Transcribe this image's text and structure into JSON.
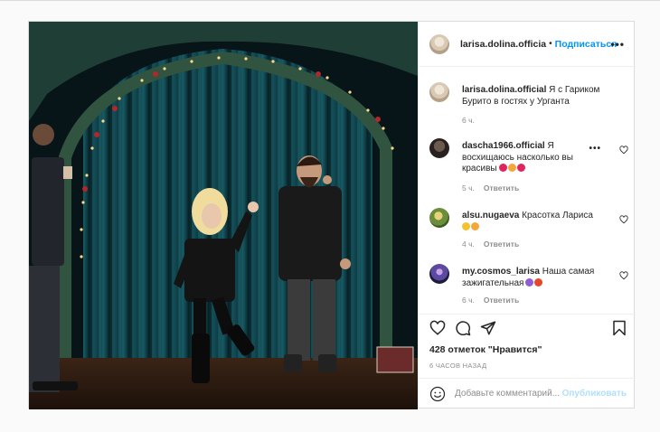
{
  "post": {
    "author": "larisa.dolina.officia",
    "follow_label": "Подписаться",
    "caption_author": "larisa.dolina.official",
    "caption_text": "Я с Гариком Бурито в гостях у Урганта",
    "caption_age": "6 ч.",
    "likes": "428 отметок \"Нравится\"",
    "time_ago": "6 ЧАСОВ НАЗАД",
    "comment_placeholder": "Добавьте комментарий...",
    "publish_label": "Опубликовать"
  },
  "comments": [
    {
      "user": "dascha1966.official",
      "text": "Я восхищаюсь насколько вы красивы",
      "age": "5 ч.",
      "reply": "Ответить",
      "emoji": [
        "red-heart",
        "heart-eyes",
        "red-heart"
      ]
    },
    {
      "user": "alsu.nugaeva",
      "text": "Красотка Лариса",
      "age": "4 ч.",
      "reply": "Ответить",
      "emoji": [
        "clap",
        "heart-eyes"
      ]
    },
    {
      "user": "my.cosmos_larisa",
      "text": "Наша самая зажигательная",
      "age": "6 ч.",
      "reply": "Ответить",
      "emoji": [
        "purple-heart",
        "collision"
      ]
    }
  ],
  "colors": {
    "link": "#0095f6",
    "muted": "#8e8e8e",
    "text": "#262626",
    "border": "#dbdbdb"
  }
}
